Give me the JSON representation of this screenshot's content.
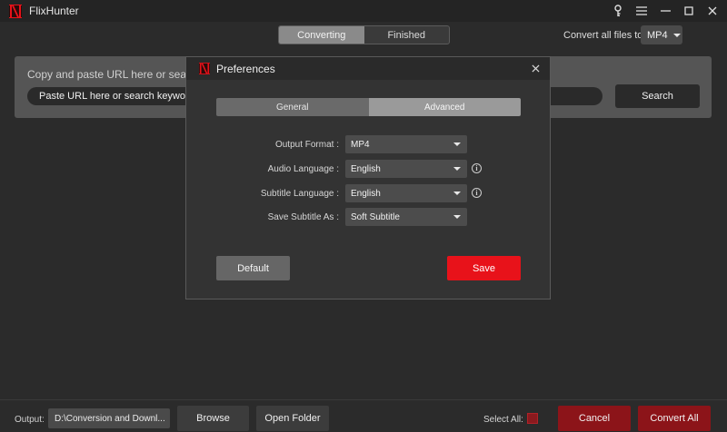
{
  "app": {
    "title": "FlixHunter"
  },
  "window_controls": {
    "items": [
      "key-icon",
      "menu-icon",
      "minimize-icon",
      "maximize-icon",
      "close-icon"
    ]
  },
  "main_tabs": [
    {
      "label": "Converting",
      "active": true
    },
    {
      "label": "Finished",
      "active": false
    }
  ],
  "convert_all": {
    "label": "Convert all files to:",
    "value": "MP4"
  },
  "url_panel": {
    "hint": "Copy and paste URL here or search",
    "input_placeholder": "Paste URL here or search keywords he",
    "search_label": "Search"
  },
  "preferences": {
    "title": "Preferences",
    "tabs": [
      {
        "label": "General",
        "active": false
      },
      {
        "label": "Advanced",
        "active": true
      }
    ],
    "rows": [
      {
        "label": "Output Format :",
        "value": "MP4",
        "info": false
      },
      {
        "label": "Audio Language :",
        "value": "English",
        "info": true
      },
      {
        "label": "Subtitle Language :",
        "value": "English",
        "info": true
      },
      {
        "label": "Save Subtitle As :",
        "value": "Soft Subtitle",
        "info": false
      }
    ],
    "default_label": "Default",
    "save_label": "Save"
  },
  "bottom": {
    "output_label": "Output:",
    "output_path": "D:\\Conversion and Downl...",
    "browse_label": "Browse",
    "open_folder_label": "Open Folder",
    "select_all_label": "Select All:",
    "cancel_label": "Cancel",
    "convert_all_label": "Convert All"
  },
  "colors": {
    "accent_red": "#e8121a",
    "dark_red": "#8c1419",
    "background": "#2b2b2b"
  }
}
